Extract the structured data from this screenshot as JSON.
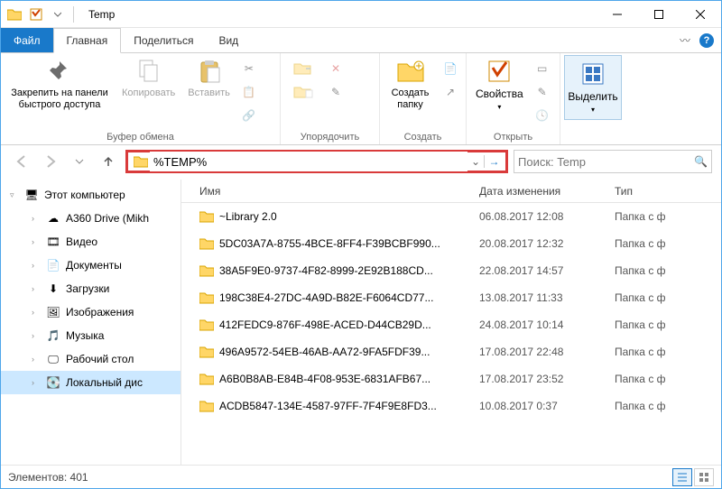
{
  "window": {
    "title": "Temp"
  },
  "tabs": {
    "file": "Файл",
    "home": "Главная",
    "share": "Поделиться",
    "view": "Вид"
  },
  "ribbon": {
    "clipboard": {
      "pin": "Закрепить на панели быстрого доступа",
      "copy": "Копировать",
      "paste": "Вставить",
      "group": "Буфер обмена"
    },
    "organize": {
      "group": "Упорядочить"
    },
    "new": {
      "newfolder": "Создать папку",
      "group": "Создать"
    },
    "open": {
      "properties": "Свойства",
      "group": "Открыть"
    },
    "select": {
      "select": "Выделить"
    }
  },
  "address": {
    "value": "%TEMP%"
  },
  "search": {
    "placeholder": "Поиск: Temp"
  },
  "nav": {
    "thispc": "Этот компьютер",
    "items": [
      {
        "label": "A360 Drive (Mikh",
        "icon": "cloud"
      },
      {
        "label": "Видео",
        "icon": "video"
      },
      {
        "label": "Документы",
        "icon": "doc"
      },
      {
        "label": "Загрузки",
        "icon": "download"
      },
      {
        "label": "Изображения",
        "icon": "pictures"
      },
      {
        "label": "Музыка",
        "icon": "music"
      },
      {
        "label": "Рабочий стол",
        "icon": "desktop"
      },
      {
        "label": "Локальный дис",
        "icon": "disk",
        "selected": true
      }
    ]
  },
  "columns": {
    "name": "Имя",
    "date": "Дата изменения",
    "type": "Тип"
  },
  "files": [
    {
      "name": "~Library 2.0",
      "date": "06.08.2017 12:08",
      "type": "Папка с ф"
    },
    {
      "name": "5DC03A7A-8755-4BCE-8FF4-F39BCBF990...",
      "date": "20.08.2017 12:32",
      "type": "Папка с ф"
    },
    {
      "name": "38A5F9E0-9737-4F82-8999-2E92B188CD...",
      "date": "22.08.2017 14:57",
      "type": "Папка с ф"
    },
    {
      "name": "198C38E4-27DC-4A9D-B82E-F6064CD77...",
      "date": "13.08.2017 11:33",
      "type": "Папка с ф"
    },
    {
      "name": "412FEDC9-876F-498E-ACED-D44CB29D...",
      "date": "24.08.2017 10:14",
      "type": "Папка с ф"
    },
    {
      "name": "496A9572-54EB-46AB-AA72-9FA5FDF39...",
      "date": "17.08.2017 22:48",
      "type": "Папка с ф"
    },
    {
      "name": "A6B0B8AB-E84B-4F08-953E-6831AFB67...",
      "date": "17.08.2017 23:52",
      "type": "Папка с ф"
    },
    {
      "name": "ACDB5847-134E-4587-97FF-7F4F9E8FD3...",
      "date": "10.08.2017 0:37",
      "type": "Папка с ф"
    }
  ],
  "status": {
    "count_label": "Элементов:",
    "count": "401"
  }
}
